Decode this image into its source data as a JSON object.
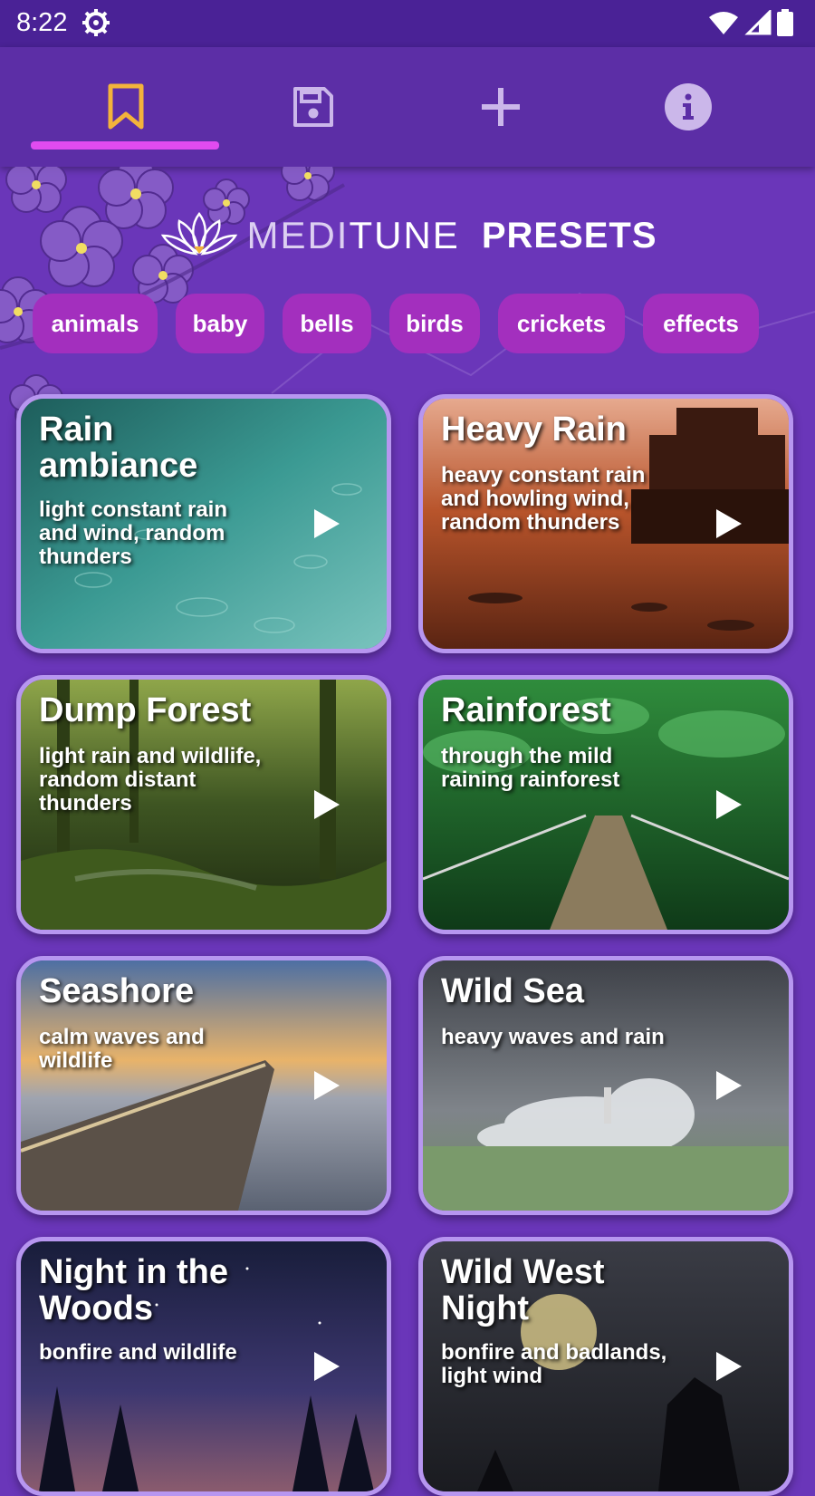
{
  "status": {
    "time": "8:22"
  },
  "tabs": [
    {
      "name": "presets",
      "active": true,
      "icon": "bookmark-icon"
    },
    {
      "name": "saved",
      "active": false,
      "icon": "save-icon"
    },
    {
      "name": "add",
      "active": false,
      "icon": "plus-icon"
    },
    {
      "name": "info",
      "active": false,
      "icon": "info-icon"
    }
  ],
  "header": {
    "logo_prefix": "MEDI",
    "logo_suffix": "TUNE",
    "title": "PRESETS"
  },
  "categories": [
    "animals",
    "baby",
    "bells",
    "birds",
    "crickets",
    "effects"
  ],
  "presets": [
    {
      "title": "Rain ambiance",
      "description": "light constant rain and wind, random thunders"
    },
    {
      "title": "Heavy Rain",
      "description": "heavy constant rain and howling wind, random thunders"
    },
    {
      "title": "Dump Forest",
      "description": "light rain and wildlife, random distant thunders"
    },
    {
      "title": "Rainforest",
      "description": "through the mild raining rainforest"
    },
    {
      "title": "Seashore",
      "description": "calm waves and wildlife"
    },
    {
      "title": "Wild Sea",
      "description": "heavy waves and rain"
    },
    {
      "title": "Night in the Woods",
      "description": "bonfire and wildlife"
    },
    {
      "title": "Wild West Night",
      "description": "bonfire and badlands, light wind"
    }
  ],
  "colors": {
    "background": "#6a36b9",
    "tabbar": "#5c2ea6",
    "statusbar": "#4a2296",
    "accent_indicator": "#e14bf0",
    "active_icon": "#f3b33b",
    "chip": "#a32fbe",
    "card_border": "#b796f0"
  }
}
